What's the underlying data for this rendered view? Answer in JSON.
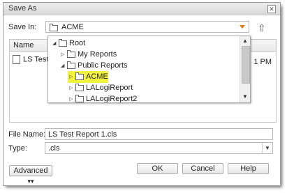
{
  "window": {
    "title": "Save As"
  },
  "save_in": {
    "label": "Save In:",
    "value": "ACME"
  },
  "list": {
    "header": "Name",
    "rows": [
      {
        "name": "LS Test",
        "modified_suffix": "1 PM"
      }
    ]
  },
  "tree": {
    "nodes": [
      {
        "label": "Root",
        "state": "expanded"
      },
      {
        "label": "My Reports",
        "state": "collapsed"
      },
      {
        "label": "Public Reports",
        "state": "expanded"
      },
      {
        "label": "ACME",
        "state": "collapsed",
        "highlighted": true
      },
      {
        "label": "LALogiReport",
        "state": "collapsed"
      },
      {
        "label": "LALogiReport2",
        "state": "collapsed"
      }
    ]
  },
  "file_name": {
    "label": "File Name:",
    "value": "LS Test Report 1.cls"
  },
  "type": {
    "label": "Type:",
    "value": ".cls"
  },
  "buttons": {
    "advanced": "Advanced",
    "ok": "OK",
    "cancel": "Cancel",
    "help": "Help"
  },
  "icons": {
    "up": "up-folder-icon",
    "advanced_chevron": "double-chevron-down-icon"
  },
  "colors": {
    "highlight": "#f2f22a",
    "dropdown_caret": "#e07a1a"
  }
}
